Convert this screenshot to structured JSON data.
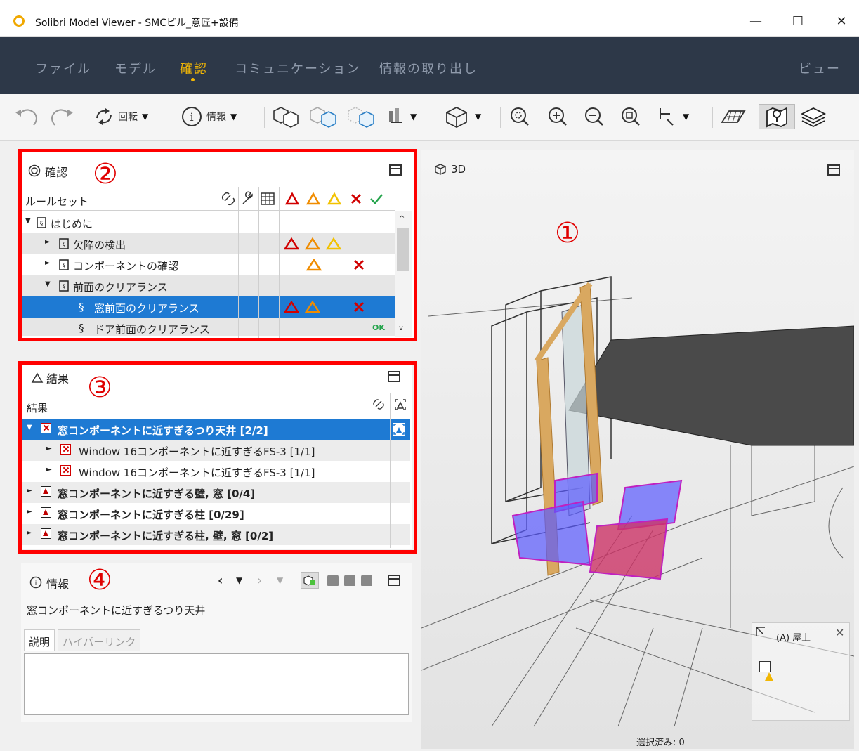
{
  "window": {
    "title": "Solibri Model Viewer - SMCビル_意匠+設備",
    "minimize": "—",
    "maximize": "☐",
    "close": "✕"
  },
  "menu": {
    "items": [
      "ファイル",
      "モデル",
      "確認",
      "コミュニケーション",
      "情報の取り出し"
    ],
    "active": "確認",
    "right": "ビュー"
  },
  "toolbar": {
    "rotate_label": "回転",
    "info_label": "情報"
  },
  "check_panel": {
    "title": "確認",
    "marker": "②",
    "column_header": "ルールセット",
    "rows": [
      {
        "label": "はじめに",
        "expander": "▼",
        "results": []
      },
      {
        "label": "欠陥の検出",
        "expander": "►",
        "results": [
          "red",
          "orange",
          "yellow"
        ]
      },
      {
        "label": "コンポーネントの確認",
        "expander": "►",
        "results": [
          "orange",
          "x"
        ]
      },
      {
        "label": "前面のクリアランス",
        "expander": "▼",
        "results": []
      },
      {
        "label": "窓前面のクリアランス",
        "expander": "§",
        "results": [
          "red",
          "orange",
          "x"
        ]
      },
      {
        "label": "ドア前面のクリアランス",
        "expander": "§",
        "results": [
          "ok"
        ]
      }
    ],
    "ok_text": "OK"
  },
  "view3d": {
    "title": "3D",
    "marker": "①",
    "minimap_label": "(A) 屋上",
    "status": "選択済み: 0"
  },
  "results_panel": {
    "title": "結果",
    "marker": "③",
    "column_header": "結果",
    "rows": [
      {
        "text": "窓コンポーネントに近すぎるつり天井 [2/2]",
        "icon": "x",
        "expander": "▼"
      },
      {
        "text": "Window 16コンポーネントに近すぎるFS-3 [1/1]",
        "icon": "x",
        "expander": "►"
      },
      {
        "text": "Window 16コンポーネントに近すぎるFS-3 [1/1]",
        "icon": "x",
        "expander": "►"
      },
      {
        "text": "窓コンポーネントに近すぎる壁, 窓 [0/4]",
        "icon": "warn",
        "expander": "►"
      },
      {
        "text": "窓コンポーネントに近すぎる柱 [0/29]",
        "icon": "warn",
        "expander": "►"
      },
      {
        "text": "窓コンポーネントに近すぎる柱, 壁, 窓 [0/2]",
        "icon": "warn",
        "expander": "►"
      }
    ]
  },
  "info_panel": {
    "title": "情報",
    "marker": "④",
    "selected_name": "窓コンポーネントに近すぎるつり天井",
    "tabs": [
      "説明",
      "ハイパーリンク"
    ]
  },
  "colors": {
    "menu_bg": "#2d3848",
    "accent": "#f2b705",
    "selection": "#1e7ad3",
    "highlight_box": "#ff0000",
    "critical": "#d10000",
    "moderate": "#f08c00",
    "low": "#f2c200",
    "ok": "#22a34a"
  }
}
